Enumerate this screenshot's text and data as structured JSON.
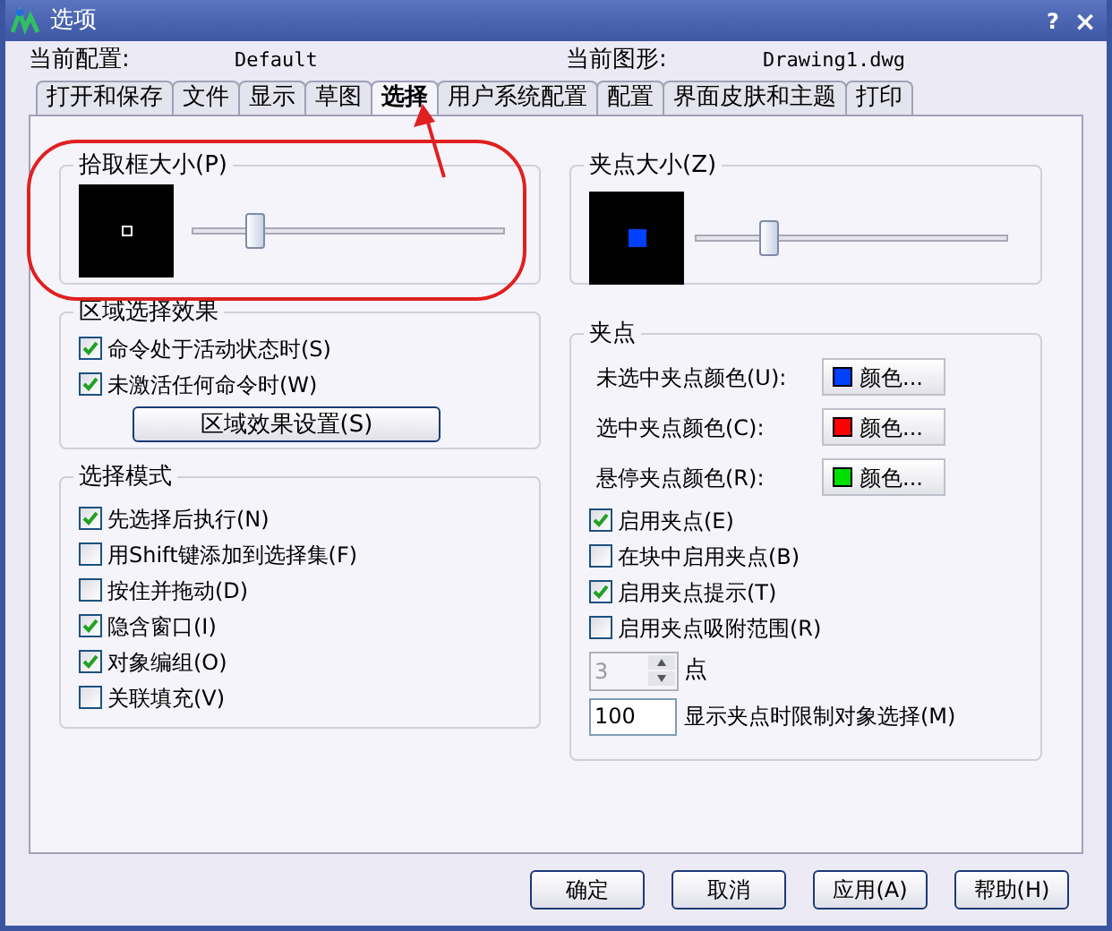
{
  "window": {
    "title": "选项",
    "help": "?",
    "close": "×"
  },
  "current_profile": {
    "label": "当前配置:",
    "value": "Default"
  },
  "current_drawing": {
    "label": "当前图形:",
    "value": "Drawing1.dwg"
  },
  "tabs": [
    {
      "label": "打开和保存",
      "selected": false
    },
    {
      "label": "文件",
      "selected": false
    },
    {
      "label": "显示",
      "selected": false
    },
    {
      "label": "草图",
      "selected": false
    },
    {
      "label": "选择",
      "selected": true
    },
    {
      "label": "用户系统配置",
      "selected": false
    },
    {
      "label": "配置",
      "selected": false
    },
    {
      "label": "界面皮肤和主题",
      "selected": false
    },
    {
      "label": "打印",
      "selected": false
    }
  ],
  "pickbox": {
    "title": "拾取框大小(P)",
    "level": 0.18
  },
  "grip_size": {
    "title": "夹点大小(Z)",
    "level": 0.22
  },
  "area_selection": {
    "title": "区域选择效果",
    "checkboxes": [
      {
        "label": "命令处于活动状态时(S)",
        "checked": true
      },
      {
        "label": "未激活任何命令时(W)",
        "checked": true
      }
    ],
    "button": "区域效果设置(S)"
  },
  "selection_modes": {
    "title": "选择模式",
    "checkboxes": [
      {
        "label": "先选择后执行(N)",
        "checked": true
      },
      {
        "label": "用Shift键添加到选择集(F)",
        "checked": false
      },
      {
        "label": "按住并拖动(D)",
        "checked": false
      },
      {
        "label": "隐含窗口(I)",
        "checked": true
      },
      {
        "label": "对象编组(O)",
        "checked": true
      },
      {
        "label": "关联填充(V)",
        "checked": false
      }
    ]
  },
  "grips": {
    "title": "夹点",
    "colors": [
      {
        "label": "未选中夹点颜色(U):",
        "button": "颜色...",
        "color": "#0040ff"
      },
      {
        "label": "选中夹点颜色(C):",
        "button": "颜色...",
        "color": "#ff0000"
      },
      {
        "label": "悬停夹点颜色(R):",
        "button": "颜色...",
        "color": "#00e000"
      }
    ],
    "checkboxes": [
      {
        "label": "启用夹点(E)",
        "checked": true
      },
      {
        "label": "在块中启用夹点(B)",
        "checked": false
      },
      {
        "label": "启用夹点提示(T)",
        "checked": true
      },
      {
        "label": "启用夹点吸附范围(R)",
        "checked": false
      }
    ],
    "spinner": {
      "value": "3",
      "disabled": true,
      "unit": "点"
    },
    "limit": {
      "value": "100",
      "label": "显示夹点时限制对象选择(M)"
    }
  },
  "buttons": [
    "确定",
    "取消",
    "应用(A)",
    "帮助(H)"
  ]
}
